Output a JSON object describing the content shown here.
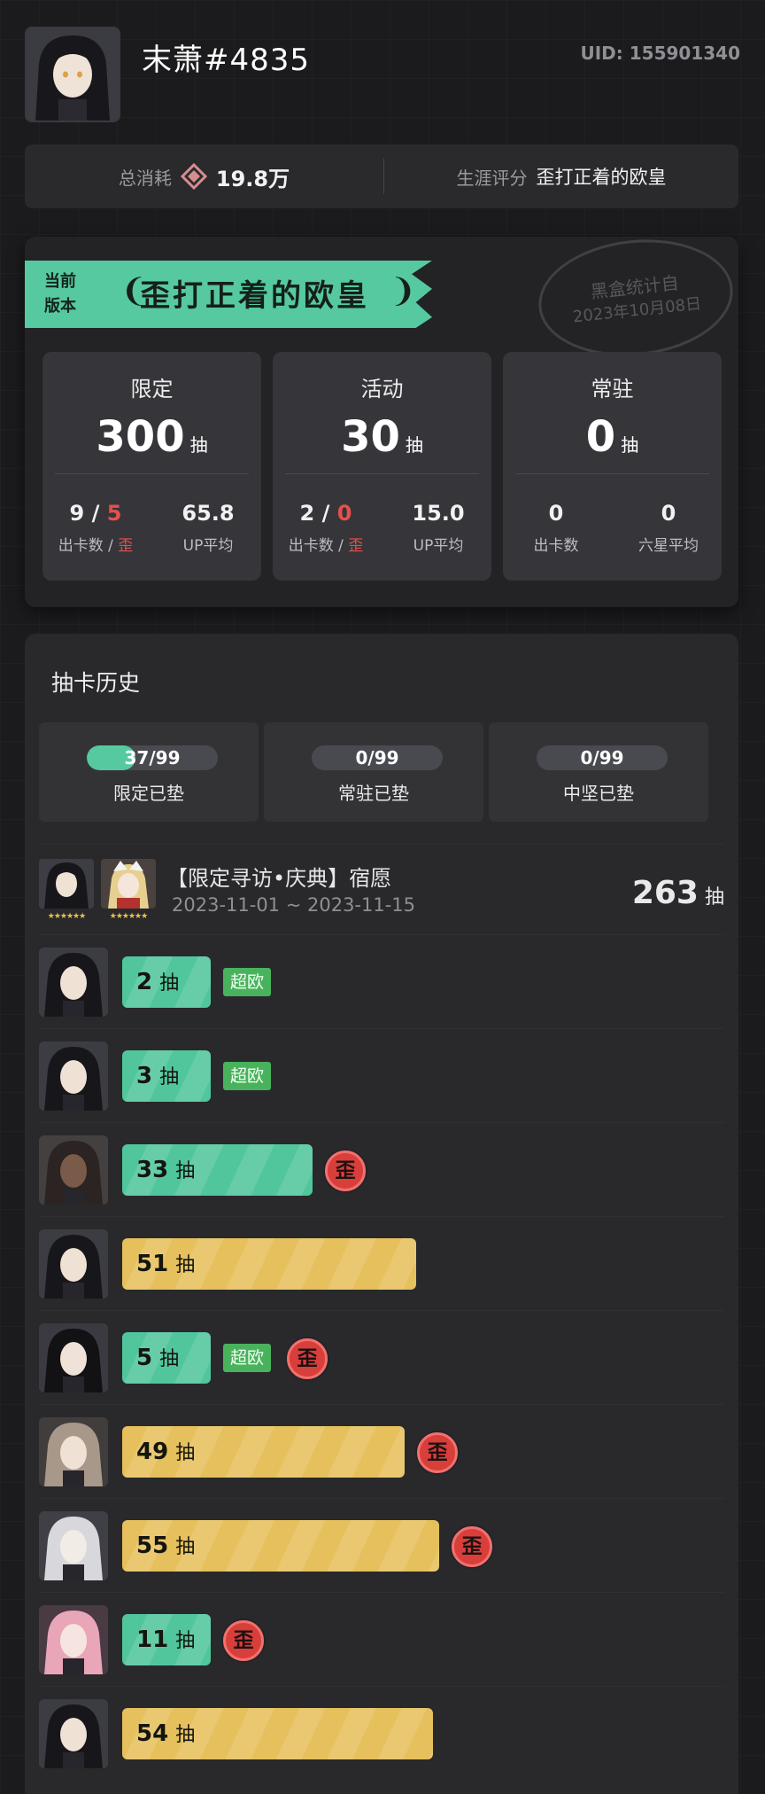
{
  "header": {
    "username": "末萧#4835",
    "uid": "UID: 155901340"
  },
  "summary": {
    "total_label": "总消耗",
    "total_value": "19.8万",
    "rating_label": "生涯评分",
    "rating_value": "歪打正着的欧皇"
  },
  "version": {
    "tag_line1": "当前",
    "tag_line2": "版本",
    "title": "歪打正着的欧皇",
    "stamp_line1": "黑盒统计自",
    "stamp_line2": "2023年10月08日",
    "pull_unit": "抽",
    "pools": [
      {
        "name": "限定",
        "total": "300",
        "stat1_a": "9",
        "stat1_sep": " / ",
        "stat1_b": "5",
        "stat1_label_a": "出卡数",
        "stat1_label_sep": " / ",
        "stat1_label_b": "歪",
        "stat2": "65.8",
        "stat2_label": "UP平均"
      },
      {
        "name": "活动",
        "total": "30",
        "stat1_a": "2",
        "stat1_sep": " / ",
        "stat1_b": "0",
        "stat1_label_a": "出卡数",
        "stat1_label_sep": " / ",
        "stat1_label_b": "歪",
        "stat2": "15.0",
        "stat2_label": "UP平均"
      },
      {
        "name": "常驻",
        "total": "0",
        "stat1_a": "0",
        "stat1_sep": "",
        "stat1_b": "",
        "stat1_label_a": "出卡数",
        "stat1_label_sep": "",
        "stat1_label_b": "",
        "stat2": "0",
        "stat2_label": "六星平均"
      }
    ]
  },
  "history": {
    "title": "抽卡历史",
    "pity": [
      {
        "value": "37/99",
        "fraction": 0.3737,
        "label": "限定已垫"
      },
      {
        "value": "0/99",
        "fraction": 0,
        "label": "常驻已垫"
      },
      {
        "value": "0/99",
        "fraction": 0,
        "label": "中坚已垫"
      }
    ],
    "banner": {
      "name": "【限定寻访•庆典】宿愿",
      "date": "2023-11-01 ~ 2023-11-15",
      "total": "263",
      "unit": "抽",
      "stars": "★★★★★★"
    },
    "pull_unit": "抽",
    "lucky_label": "超欧",
    "off_label": "歪",
    "pulls": [
      {
        "count": "2",
        "color": "green",
        "lucky": true,
        "off": false
      },
      {
        "count": "3",
        "color": "green",
        "lucky": true,
        "off": false
      },
      {
        "count": "33",
        "color": "green",
        "lucky": false,
        "off": true
      },
      {
        "count": "51",
        "color": "yellow",
        "lucky": false,
        "off": false
      },
      {
        "count": "5",
        "color": "green",
        "lucky": true,
        "off": true
      },
      {
        "count": "49",
        "color": "yellow",
        "lucky": false,
        "off": true
      },
      {
        "count": "55",
        "color": "yellow",
        "lucky": false,
        "off": true
      },
      {
        "count": "11",
        "color": "green",
        "lucky": false,
        "off": true
      },
      {
        "count": "54",
        "color": "yellow",
        "lucky": false,
        "off": false
      }
    ]
  },
  "colors": {
    "accent_green": "#56c9a0",
    "accent_yellow": "#e6c05d",
    "off_red": "#d83e3a",
    "lucky_green": "#49b25d"
  }
}
